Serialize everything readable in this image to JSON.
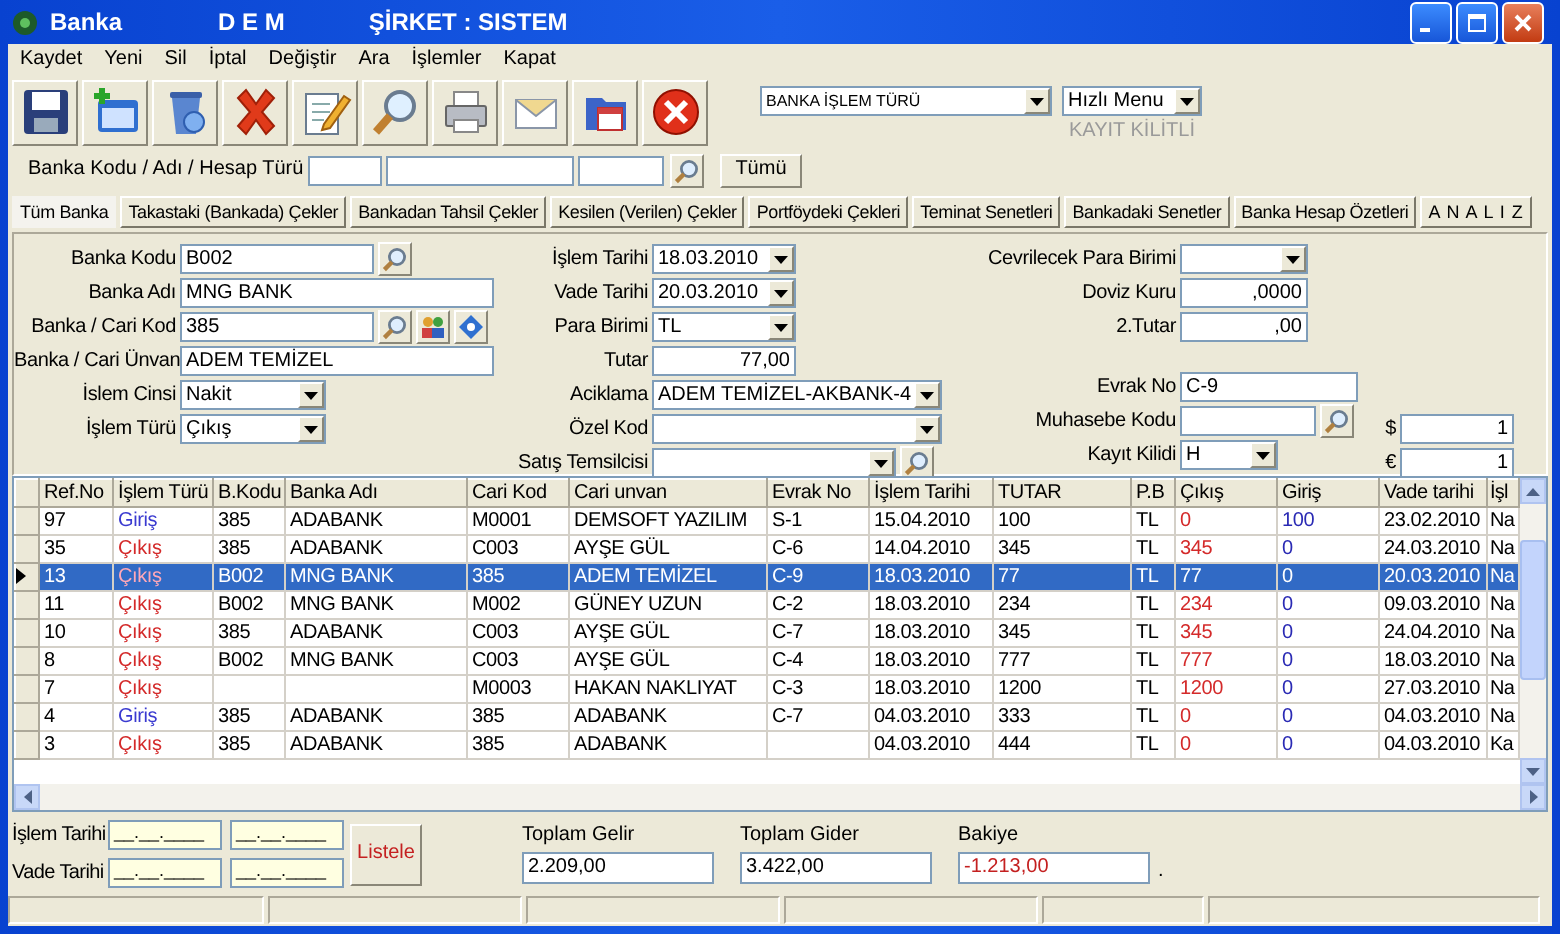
{
  "window": {
    "title": "Banka",
    "user": "D E M",
    "company": "ŞİRKET : SISTEM"
  },
  "menu": [
    "Kaydet",
    "Yeni",
    "Sil",
    "İptal",
    "Değiştir",
    "Ara",
    "İşlemler",
    "Kapat"
  ],
  "toolbar": {
    "operation_type": "BANKA İŞLEM TÜRÜ",
    "quick_menu": "Hızlı Menu",
    "lock_status": "KAYIT KİLİTLİ"
  },
  "search": {
    "label": "Banka Kodu / Adı / Hesap Türü",
    "button": "Tümü"
  },
  "tabs": [
    {
      "label": "Tüm Banka",
      "selected": true
    },
    {
      "label": "Takastaki (Bankada) Çekler",
      "selected": false
    },
    {
      "label": "Bankadan Tahsil Çekler",
      "selected": false
    },
    {
      "label": "Kesilen (Verilen) Çekler",
      "selected": false
    },
    {
      "label": "Portföydeki Çekleri",
      "selected": false
    },
    {
      "label": "Teminat Senetleri",
      "selected": false
    },
    {
      "label": "Bankadaki Senetler",
      "selected": false
    },
    {
      "label": "Banka Hesap Özetleri",
      "selected": false
    },
    {
      "label": "A N A L I Z",
      "selected": false
    }
  ],
  "form": {
    "left": [
      {
        "label": "Banka Kodu",
        "kind": "lookup",
        "value": "B002"
      },
      {
        "label": "Banka Adı",
        "kind": "text",
        "value": "MNG BANK"
      },
      {
        "label": "Banka / Cari Kod",
        "kind": "contact-lookup",
        "value": "385"
      },
      {
        "label": "Banka / Cari Ünvan",
        "kind": "text",
        "value": "ADEM TEMİZEL"
      },
      {
        "label": "İslem Cinsi",
        "kind": "combo",
        "value": "Nakit"
      },
      {
        "label": "İşlem Türü",
        "kind": "combo",
        "value": "Çıkış"
      }
    ],
    "middle": [
      {
        "label": "İşlem Tarihi",
        "kind": "combo",
        "value": "18.03.2010"
      },
      {
        "label": "Vade Tarihi",
        "kind": "combo",
        "value": "20.03.2010"
      },
      {
        "label": "Para Birimi",
        "kind": "combo",
        "value": "TL"
      },
      {
        "label": "Tutar",
        "kind": "number",
        "value": "77,00"
      },
      {
        "label": "Aciklama",
        "kind": "combo",
        "value": "ADEM TEMİZEL-AKBANK-4"
      },
      {
        "label": "Özel Kod",
        "kind": "combo"
      },
      {
        "label": "Satış Temsilcisi",
        "kind": "combo-lookup"
      }
    ],
    "right": [
      {
        "label": "Cevrilecek Para Birimi",
        "kind": "combo"
      },
      {
        "label": "Doviz Kuru",
        "kind": "number",
        "value": ",0000"
      },
      {
        "label": "2.Tutar",
        "kind": "number",
        "value": ",00"
      },
      {
        "label": "Evrak No",
        "kind": "text",
        "value": "C-9"
      },
      {
        "label": "Muhasebe Kodu",
        "kind": "lookup"
      },
      {
        "label": "Kayıt Kilidi",
        "kind": "combo",
        "value": "H"
      }
    ],
    "rates": [
      {
        "label": "$",
        "kind": "number",
        "value": "1"
      },
      {
        "label": "€",
        "kind": "number",
        "value": "1"
      }
    ]
  },
  "table": {
    "columns": [
      {
        "label": "Ref.No"
      },
      {
        "label": "İşlem Türü"
      },
      {
        "label": "B.Kodu"
      },
      {
        "label": "Banka Adı"
      },
      {
        "label": "Cari Kod"
      },
      {
        "label": "Cari unvan"
      },
      {
        "label": "Evrak No"
      },
      {
        "label": "İşlem Tarihi"
      },
      {
        "label": "TUTAR"
      },
      {
        "label": "P.B"
      },
      {
        "label": "Çıkış",
        "color": "#d42a2a"
      },
      {
        "label": "Giriş",
        "color": "#2a2ab4"
      },
      {
        "label": "Vade tarihi"
      },
      {
        "label": "İşl"
      }
    ],
    "rows": [
      {
        "selected": false,
        "kind": "in",
        "cells": [
          "97",
          "Giriş",
          "385",
          "ADABANK",
          "M0001",
          "DEMSOFT YAZILIM",
          "S-1",
          "15.04.2010",
          "100",
          "TL",
          "0",
          "100",
          "23.02.2010",
          "Na"
        ]
      },
      {
        "selected": false,
        "kind": "out",
        "cells": [
          "35",
          "Çıkış",
          "385",
          "ADABANK",
          "C003",
          "AYŞE GÜL",
          "C-6",
          "14.04.2010",
          "345",
          "TL",
          "345",
          "0",
          "24.03.2010",
          "Na"
        ]
      },
      {
        "selected": true,
        "kind": "out",
        "cells": [
          "13",
          "Çıkış",
          "B002",
          "MNG BANK",
          "385",
          "ADEM TEMİZEL",
          "C-9",
          "18.03.2010",
          "77",
          "TL",
          "77",
          "0",
          "20.03.2010",
          "Na"
        ]
      },
      {
        "selected": false,
        "kind": "out",
        "cells": [
          "11",
          "Çıkış",
          "B002",
          "MNG BANK",
          "M002",
          "GÜNEY UZUN",
          "C-2",
          "18.03.2010",
          "234",
          "TL",
          "234",
          "0",
          "09.03.2010",
          "Na"
        ]
      },
      {
        "selected": false,
        "kind": "out",
        "cells": [
          "10",
          "Çıkış",
          "385",
          "ADABANK",
          "C003",
          "AYŞE GÜL",
          "C-7",
          "18.03.2010",
          "345",
          "TL",
          "345",
          "0",
          "24.04.2010",
          "Na"
        ]
      },
      {
        "selected": false,
        "kind": "out",
        "cells": [
          "8",
          "Çıkış",
          "B002",
          "MNG BANK",
          "C003",
          "AYŞE GÜL",
          "C-4",
          "18.03.2010",
          "777",
          "TL",
          "777",
          "0",
          "18.03.2010",
          "Na"
        ]
      },
      {
        "selected": false,
        "kind": "out",
        "cells": [
          "7",
          "Çıkış",
          null,
          null,
          "M0003",
          "HAKAN NAKLIYAT",
          "C-3",
          "18.03.2010",
          "1200",
          "TL",
          "1200",
          "0",
          "27.03.2010",
          "Na"
        ]
      },
      {
        "selected": false,
        "kind": "in",
        "cells": [
          "4",
          "Giriş",
          "385",
          "ADABANK",
          "385",
          "ADABANK",
          "C-7",
          "04.03.2010",
          "333",
          "TL",
          "0",
          "0",
          "04.03.2010",
          "Na"
        ]
      },
      {
        "selected": false,
        "kind": "out",
        "cells": [
          "3",
          "Çıkış",
          "385",
          "ADABANK",
          "385",
          "ADABANK",
          null,
          "04.03.2010",
          "444",
          "TL",
          "0",
          "0",
          "04.03.2010",
          "Ka"
        ]
      }
    ]
  },
  "filter": {
    "rows": [
      {
        "label": "İşlem Tarihi",
        "from": "__.__.____",
        "to": "__.__.____"
      },
      {
        "label": "Vade Tarihi",
        "from": "__.__.____",
        "to": "__.__.____"
      }
    ],
    "button": "Listele"
  },
  "totals": [
    {
      "label": "Toplam Gelir",
      "value": "2.209,00",
      "negative": false
    },
    {
      "label": "Toplam Gider",
      "value": "3.422,00",
      "negative": false
    },
    {
      "label": "Bakiye",
      "value": "-1.213,00",
      "negative": true,
      "suffix": "."
    }
  ]
}
